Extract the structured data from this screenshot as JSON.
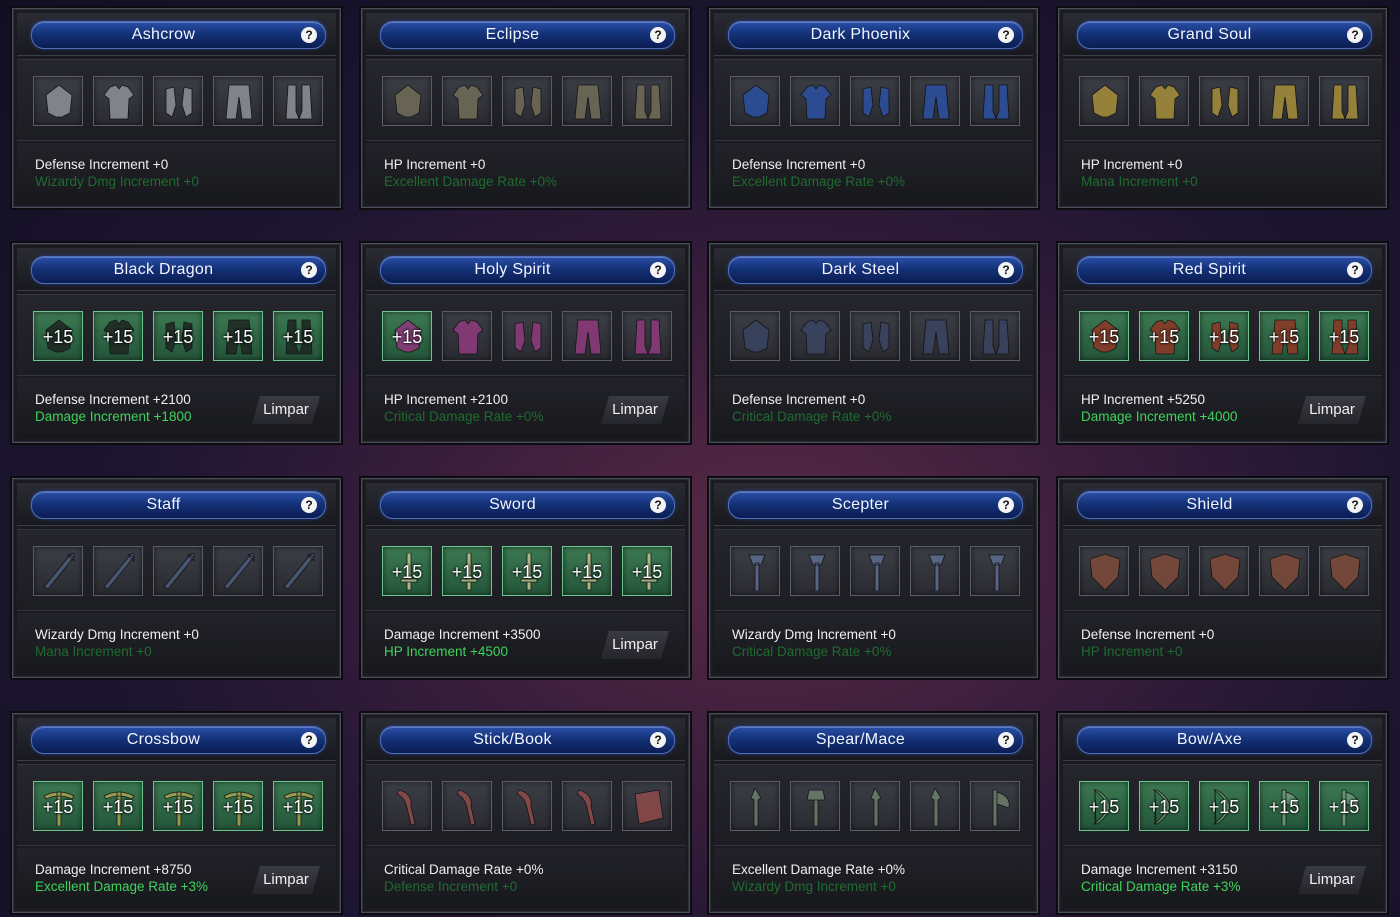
{
  "clear_label": "Limpar",
  "help_glyph": "?",
  "sets": [
    {
      "name": "Ashcrow",
      "upgraded": false,
      "level": "",
      "icon_color": "#8a8c94",
      "icons": [
        "helm-icon",
        "armor-icon",
        "gloves-icon",
        "pants-icon",
        "boots-icon"
      ],
      "stat1": "Defense Increment +0",
      "stat2": "Wizardy Dmg Increment +0",
      "stat2_active": false,
      "show_clear": false
    },
    {
      "name": "Eclipse",
      "upgraded": false,
      "level": "",
      "icon_color": "#6e6a58",
      "icons": [
        "helm-icon",
        "armor-icon",
        "gloves-icon",
        "pants-icon",
        "boots-icon"
      ],
      "stat1": "HP Increment +0",
      "stat2": "Excellent Damage Rate +0%",
      "stat2_active": false,
      "show_clear": false
    },
    {
      "name": "Dark Phoenix",
      "upgraded": false,
      "level": "",
      "icon_color": "#2c4f9c",
      "icons": [
        "helm-icon",
        "armor-icon",
        "gloves-icon",
        "pants-icon",
        "boots-icon"
      ],
      "stat1": "Defense Increment +0",
      "stat2": "Excellent Damage Rate +0%",
      "stat2_active": false,
      "show_clear": false
    },
    {
      "name": "Grand Soul",
      "upgraded": false,
      "level": "",
      "icon_color": "#a08a3a",
      "icons": [
        "helm-icon",
        "armor-icon",
        "gloves-icon",
        "pants-icon",
        "boots-icon"
      ],
      "stat1": "HP Increment +0",
      "stat2": "Mana Increment +0",
      "stat2_active": false,
      "show_clear": false
    },
    {
      "name": "Black Dragon",
      "upgraded": true,
      "level": "+15",
      "icon_color": "#1e2a24",
      "icons": [
        "helm-icon",
        "armor-icon",
        "gloves-icon",
        "pants-icon",
        "boots-icon"
      ],
      "stat1": "Defense Increment +2100",
      "stat2": "Damage Increment +1800",
      "stat2_active": true,
      "show_clear": true
    },
    {
      "name": "Holy Spirit",
      "upgraded": false,
      "level": "",
      "icon_color": "#8a3a7a",
      "first_level": "+15",
      "icons": [
        "helm-icon",
        "armor-icon",
        "gloves-icon",
        "pants-icon",
        "boots-icon"
      ],
      "stat1": "HP Increment +2100",
      "stat2": "Critical Damage Rate +0%",
      "stat2_active": false,
      "show_clear": true
    },
    {
      "name": "Dark Steel",
      "upgraded": false,
      "level": "",
      "icon_color": "#3a4460",
      "icons": [
        "helm-icon",
        "armor-icon",
        "gloves-icon",
        "pants-icon",
        "boots-icon"
      ],
      "stat1": "Defense Increment +0",
      "stat2": "Critical Damage Rate +0%",
      "stat2_active": false,
      "show_clear": false
    },
    {
      "name": "Red Spirit",
      "upgraded": true,
      "level": "+15",
      "icon_color": "#8a3a28",
      "icons": [
        "helm-icon",
        "armor-icon",
        "gloves-icon",
        "pants-icon",
        "boots-icon"
      ],
      "stat1": "HP Increment +5250",
      "stat2": "Damage Increment +4000",
      "stat2_active": true,
      "show_clear": true
    },
    {
      "name": "Staff",
      "upgraded": false,
      "level": "",
      "icon_color": "#4a5a78",
      "icons": [
        "staff-icon",
        "staff-icon",
        "staff-icon",
        "staff-icon",
        "staff-icon"
      ],
      "stat1": "Wizardy Dmg Increment +0",
      "stat2": "Mana Increment +0",
      "stat2_active": false,
      "show_clear": false
    },
    {
      "name": "Sword",
      "upgraded": true,
      "level": "+15",
      "icon_color": "#b8c08a",
      "icons": [
        "sword-icon",
        "sword-icon",
        "sword-icon",
        "sword-icon",
        "sword-icon"
      ],
      "stat1": "Damage Increment +3500",
      "stat2": "HP Increment +4500",
      "stat2_active": true,
      "show_clear": true
    },
    {
      "name": "Scepter",
      "upgraded": false,
      "level": "",
      "icon_color": "#5a6a8a",
      "icons": [
        "scepter-icon",
        "scepter-icon",
        "scepter-icon",
        "scepter-icon",
        "scepter-icon"
      ],
      "stat1": "Wizardy Dmg Increment +0",
      "stat2": "Critical Damage Rate +0%",
      "stat2_active": false,
      "show_clear": false
    },
    {
      "name": "Shield",
      "upgraded": false,
      "level": "",
      "icon_color": "#7a4a3a",
      "icons": [
        "shield-icon",
        "shield-icon",
        "shield-icon",
        "shield-icon",
        "shield-icon"
      ],
      "stat1": "Defense Increment +0",
      "stat2": "HP Increment +0",
      "stat2_active": false,
      "show_clear": false
    },
    {
      "name": "Crossbow",
      "upgraded": true,
      "level": "+15",
      "icon_color": "#a0a050",
      "icons": [
        "crossbow-icon",
        "crossbow-icon",
        "crossbow-icon",
        "crossbow-icon",
        "crossbow-icon"
      ],
      "stat1": "Damage Increment +8750",
      "stat2": "Excellent Damage Rate +3%",
      "stat2_active": true,
      "show_clear": true
    },
    {
      "name": "Stick/Book",
      "upgraded": false,
      "level": "",
      "icon_color": "#8a4a4a",
      "icons": [
        "stick-icon",
        "stick-icon",
        "stick-icon",
        "stick-icon",
        "book-icon"
      ],
      "stat1": "Critical Damage Rate +0%",
      "stat2": "Defense Increment +0",
      "stat2_active": false,
      "show_clear": false
    },
    {
      "name": "Spear/Mace",
      "upgraded": false,
      "level": "",
      "icon_color": "#6a7a6a",
      "icons": [
        "spear-icon",
        "mace-icon",
        "spear-icon",
        "spear-icon",
        "axe-icon"
      ],
      "stat1": "Excellent Damage Rate +0%",
      "stat2": "Wizardy Dmg Increment +0",
      "stat2_active": false,
      "show_clear": false
    },
    {
      "name": "Bow/Axe",
      "upgraded": true,
      "level": "+15",
      "icon_color": "#6a9a7a",
      "icons": [
        "bow-icon",
        "bow-icon",
        "bow-icon",
        "axe-icon",
        "axe-icon"
      ],
      "stat1": "Damage Increment +3150",
      "stat2": "Critical Damage Rate +3%",
      "stat2_active": true,
      "show_clear": true
    }
  ]
}
